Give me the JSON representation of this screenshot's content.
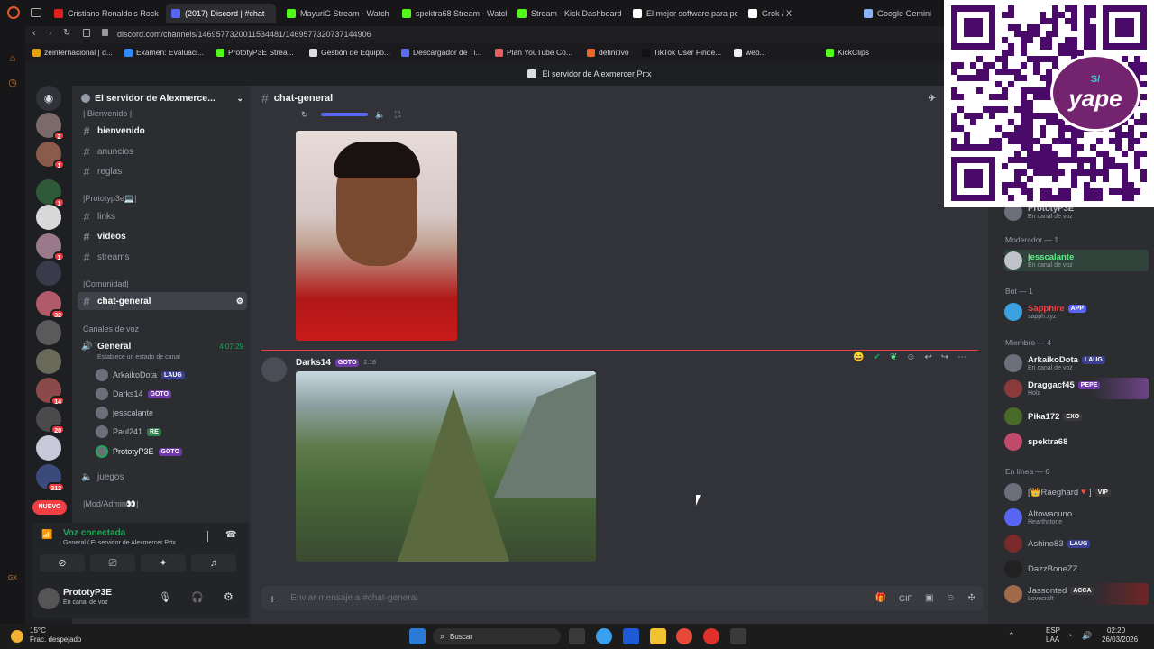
{
  "browser": {
    "tabs": [
      {
        "title": "Cristiano Ronaldo's Rocke",
        "color": "#e02020"
      },
      {
        "title": "(2017) Discord | #chat",
        "color": "#5865f2"
      },
      {
        "title": "MayuriG Stream - Watch L",
        "color": "#53fc18"
      },
      {
        "title": "spektra68 Stream - Watch",
        "color": "#53fc18"
      },
      {
        "title": "Stream - Kick Dashboard",
        "color": "#53fc18"
      },
      {
        "title": "El mejor software para po",
        "color": "#ffffff"
      },
      {
        "title": "Grok / X",
        "color": "#ffffff"
      },
      {
        "title": "Google Gemini",
        "color": "#8ab4f8"
      }
    ],
    "url": "discord.com/channels/1469577320011534481/1469577320737144906",
    "bookmarks": [
      {
        "label": "zeinternacional | d...",
        "color": "#e5a00d"
      },
      {
        "label": "Examen: Evaluaci...",
        "color": "#2d8cff"
      },
      {
        "label": "PrototyP3E Strea...",
        "color": "#53fc18"
      },
      {
        "label": "Gestión de Equipo...",
        "color": "#dddddd"
      },
      {
        "label": "Descargador de Ti...",
        "color": "#5b6cf0"
      },
      {
        "label": "Plan YouTube Co...",
        "color": "#e86060"
      },
      {
        "label": "definitivo",
        "color": "#f26522"
      },
      {
        "label": "TikTok User Finde...",
        "color": "#111111"
      },
      {
        "label": "web...",
        "color": "#eeeeee"
      },
      {
        "label": "KickClips",
        "color": "#53fc18"
      }
    ]
  },
  "discord": {
    "window_title": "El servidor de Alexmercer Prtx",
    "server_name": "El servidor de Alexmerce...",
    "server_badges": [
      "2",
      "1",
      "1",
      "1",
      "32",
      "14",
      "20",
      "312"
    ],
    "new_label": "NUEVO",
    "categories": {
      "welcome": "| Bienvenido |",
      "prototype": "|Prototyp3e💻|",
      "community": "|Comunidad|",
      "voice": "Canales de voz",
      "mod": "|Mod/Admin👀|"
    },
    "channels": {
      "bienvenido": "bienvenido",
      "anuncios": "anuncios",
      "reglas": "reglas",
      "links": "links",
      "videos": "videos",
      "streams": "streams",
      "chat_general": "chat-general",
      "juegos": "juegos"
    },
    "voice_channel": {
      "name": "General",
      "timer": "4:07:29",
      "status": "Establece un estado de canal",
      "users": [
        {
          "name": "ArkaikoDota",
          "tag": "LAUG",
          "tag_color": "#3b3f8f"
        },
        {
          "name": "Darks14",
          "tag": "GOTO",
          "tag_color": "#6e3aa8"
        },
        {
          "name": "jesscalante",
          "tag": "",
          "tag_color": ""
        },
        {
          "name": "Paul241",
          "tag": "RE",
          "tag_color": "#2f7d4a"
        },
        {
          "name": "PrototyP3E",
          "tag": "GOTO",
          "tag_color": "#6e3aa8"
        }
      ]
    },
    "voice_panel": {
      "status": "Voz conectada",
      "location": "General / El servidor de Alexmercer Prtx"
    },
    "user_panel": {
      "name": "PrototyP3E",
      "status": "En canal de voz"
    },
    "chat": {
      "channel": "chat-general",
      "message_author": "Darks14",
      "message_tag": "GOTO",
      "message_time": "2:18",
      "input_placeholder": "Enviar mensaje a #chat-general"
    },
    "members": {
      "top_partial": {
        "name": "PrototyP3E",
        "status": "En canal de voz"
      },
      "groups": [
        {
          "label": "Moderador — 1",
          "members": [
            {
              "name": "jesscalante",
              "status": "En canal de voz",
              "color": "#57f287",
              "tag": ""
            }
          ]
        },
        {
          "label": "Bot — 1",
          "members": [
            {
              "name": "Sapphire",
              "status": "sapph.xyz",
              "color": "#ed4245",
              "tag": "APP"
            }
          ]
        },
        {
          "label": "Miembro — 4",
          "members": [
            {
              "name": "ArkaikoDota",
              "status": "En canal de voz",
              "color": "#f2f3f5",
              "tag": "LAUG"
            },
            {
              "name": "Draggacf45",
              "status": "Hola",
              "color": "#f2f3f5",
              "tag": "PEPE"
            },
            {
              "name": "Pika172",
              "status": "",
              "color": "#f2f3f5",
              "tag": "EXO"
            },
            {
              "name": "spektra68",
              "status": "",
              "color": "#f2f3f5",
              "tag": ""
            }
          ]
        },
        {
          "label": "En línea — 6",
          "members": [
            {
              "name": "[👑Raeghard🔻]",
              "status": "",
              "color": "#b5bac1",
              "tag": "VIP"
            },
            {
              "name": "Altowacuno",
              "status": "Hearthstone",
              "color": "#b5bac1",
              "tag": ""
            },
            {
              "name": "Ashino83",
              "status": "",
              "color": "#b5bac1",
              "tag": "LAUG"
            },
            {
              "name": "DazzBoneZZ",
              "status": "",
              "color": "#b5bac1",
              "tag": ""
            },
            {
              "name": "Jassonted",
              "status": "Lovecraft",
              "color": "#b5bac1",
              "tag": "ACCA"
            }
          ]
        }
      ]
    }
  },
  "overlay": {
    "qr_brand": "yape",
    "qr_symbol": "S/"
  },
  "taskbar": {
    "weather_temp": "15°C",
    "weather_desc": "Frac. despejado",
    "search_placeholder": "Buscar",
    "lang1": "ESP",
    "lang2": "LAA",
    "time": "02:20",
    "date": "26/03/2026"
  }
}
